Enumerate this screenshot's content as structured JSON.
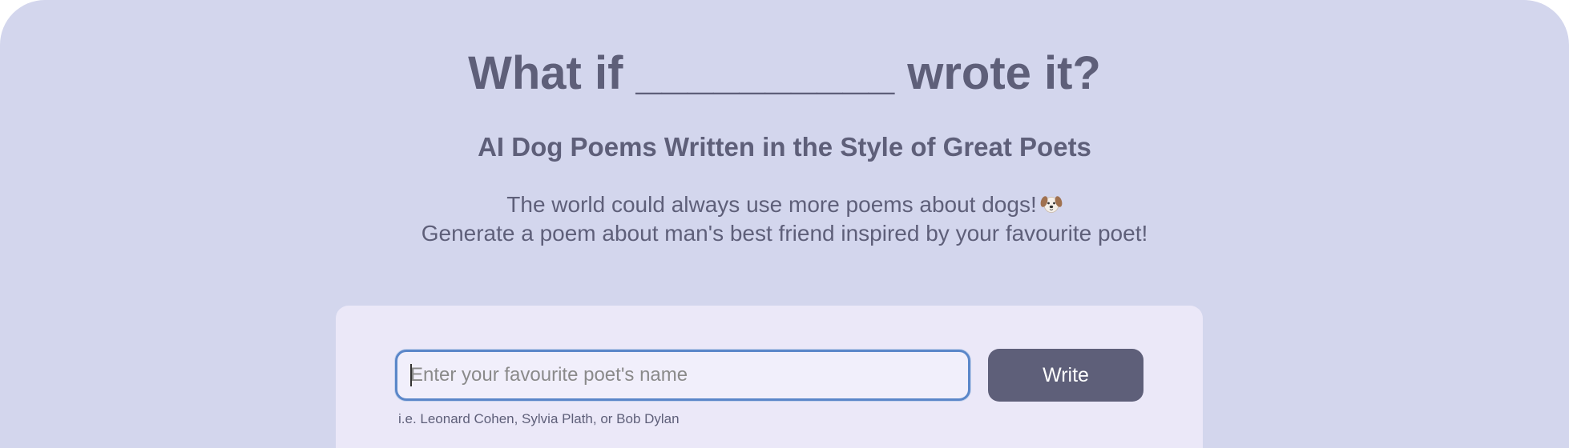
{
  "header": {
    "title": "What if __________ wrote it?",
    "subtitle": "AI Dog Poems Written in the Style of Great Poets",
    "description_line1": "The world could always use more poems about dogs!",
    "description_line2": "Generate a poem about man's best friend inspired by your favourite poet!",
    "emoji_icon": "dog-face-icon"
  },
  "form": {
    "input_value": "",
    "input_placeholder": "Enter your favourite poet's name",
    "button_label": "Write",
    "hint": "i.e. Leonard Cohen, Sylvia Plath, or Bob Dylan"
  },
  "colors": {
    "background": "#d3d6ed",
    "card": "#ebe8f8",
    "text": "#5e5f79",
    "button": "#5e5f79",
    "input_focus_border": "#5b87c9"
  }
}
